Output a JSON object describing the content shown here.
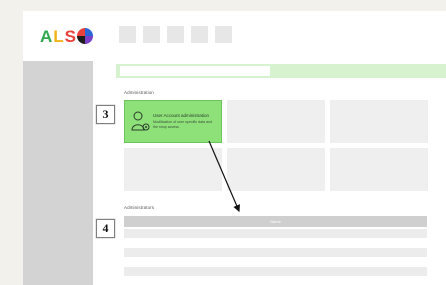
{
  "brand": {
    "logo_text": [
      "A",
      "L",
      "S",
      "O"
    ]
  },
  "sections": {
    "administration_label": "Administration",
    "administrators_label": "Administrators"
  },
  "active_tile": {
    "title": "User Account administration",
    "description": "Modification of user specific data and the shop access"
  },
  "callouts": {
    "step3": "3",
    "step4": "4"
  },
  "table": {
    "header": "Name"
  },
  "colors": {
    "accent_green": "#8ee179",
    "banner_green": "#d6f2cf",
    "sidebar_gray": "#d3d3d3"
  }
}
